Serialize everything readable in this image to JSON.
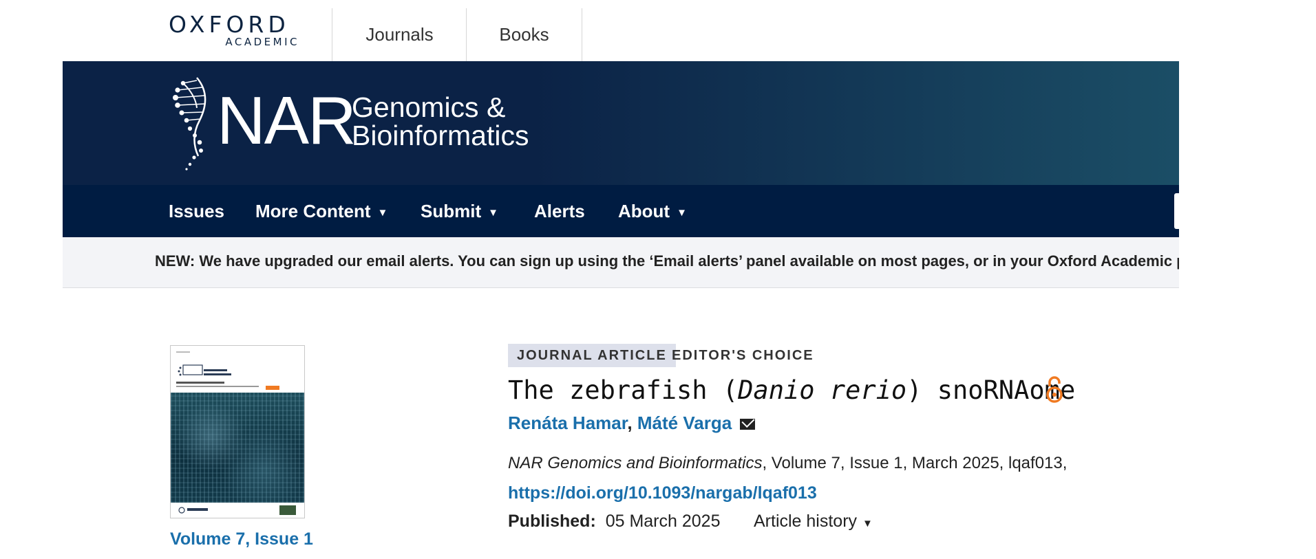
{
  "oxford_bar": {
    "logo_line1": "OXFORD",
    "logo_line2": "ACADEMIC",
    "nav": [
      "Journals",
      "Books"
    ]
  },
  "journal": {
    "abbrev": "NAR",
    "name_line1": "Genomics &",
    "name_line2": "Bioinformatics"
  },
  "main_nav": [
    {
      "label": "Issues",
      "has_dropdown": false
    },
    {
      "label": "More Content",
      "has_dropdown": true
    },
    {
      "label": "Submit",
      "has_dropdown": true
    },
    {
      "label": "Alerts",
      "has_dropdown": false
    },
    {
      "label": "About",
      "has_dropdown": true
    }
  ],
  "dropdown_caret": "▼",
  "notice": "NEW: We have upgraded our email alerts. You can sign up using the ‘Email alerts’ panel available on most pages, or in your Oxford Academic personal account.",
  "issue": {
    "volume_link": "Volume 7, Issue 1"
  },
  "article": {
    "type_tag": "JOURNAL ARTICLE",
    "choice_tag": "EDITOR'S CHOICE",
    "title_prefix": "The zebrafish (",
    "title_species": "Danio rerio",
    "title_suffix": ") snoRNAome",
    "authors": [
      "Renáta Hamar",
      "Máté Varga"
    ],
    "author_separator": ",",
    "citation_journal": "NAR Genomics and Bioinformatics",
    "citation_rest": ", Volume 7, Issue 1, March 2025, lqaf013,",
    "doi": "https://doi.org/10.1093/nargab/lqaf013",
    "published_label": "Published:",
    "published_date": "05 March 2025",
    "history_label": "Article history"
  },
  "colors": {
    "banner_dark": "#0b2246",
    "banner_light": "#1b4e66",
    "nav_bg": "#001c42",
    "link_blue": "#1a6fab",
    "open_access_orange": "#f07a22",
    "tag_bg": "#dde0eb"
  },
  "icons": [
    "dna-helix-icon",
    "open-access-icon",
    "envelope-icon",
    "caret-down-icon"
  ]
}
